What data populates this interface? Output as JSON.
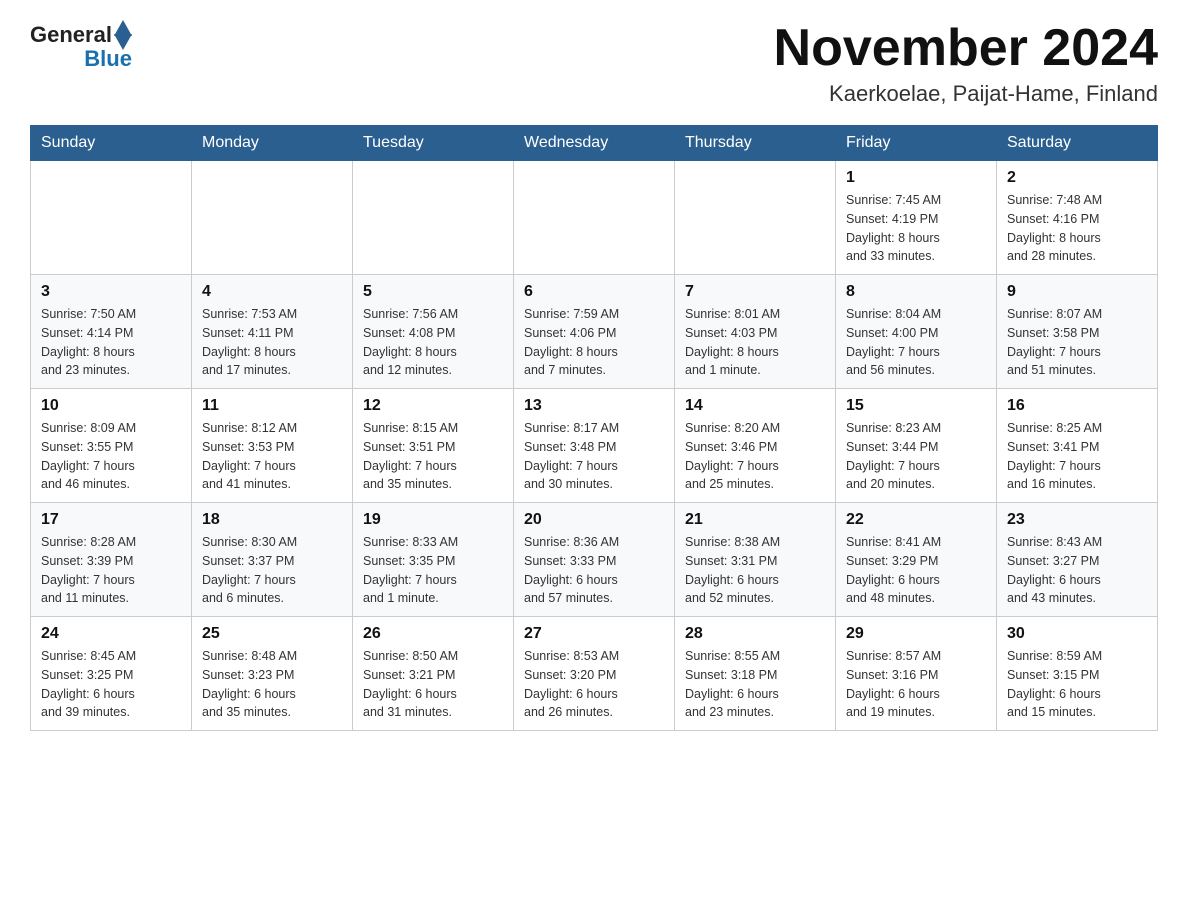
{
  "header": {
    "logo": {
      "general": "General",
      "blue": "Blue"
    },
    "title": "November 2024",
    "subtitle": "Kaerkoelae, Paijat-Hame, Finland"
  },
  "weekdays": [
    "Sunday",
    "Monday",
    "Tuesday",
    "Wednesday",
    "Thursday",
    "Friday",
    "Saturday"
  ],
  "weeks": [
    [
      {
        "day": "",
        "info": ""
      },
      {
        "day": "",
        "info": ""
      },
      {
        "day": "",
        "info": ""
      },
      {
        "day": "",
        "info": ""
      },
      {
        "day": "",
        "info": ""
      },
      {
        "day": "1",
        "info": "Sunrise: 7:45 AM\nSunset: 4:19 PM\nDaylight: 8 hours\nand 33 minutes."
      },
      {
        "day": "2",
        "info": "Sunrise: 7:48 AM\nSunset: 4:16 PM\nDaylight: 8 hours\nand 28 minutes."
      }
    ],
    [
      {
        "day": "3",
        "info": "Sunrise: 7:50 AM\nSunset: 4:14 PM\nDaylight: 8 hours\nand 23 minutes."
      },
      {
        "day": "4",
        "info": "Sunrise: 7:53 AM\nSunset: 4:11 PM\nDaylight: 8 hours\nand 17 minutes."
      },
      {
        "day": "5",
        "info": "Sunrise: 7:56 AM\nSunset: 4:08 PM\nDaylight: 8 hours\nand 12 minutes."
      },
      {
        "day": "6",
        "info": "Sunrise: 7:59 AM\nSunset: 4:06 PM\nDaylight: 8 hours\nand 7 minutes."
      },
      {
        "day": "7",
        "info": "Sunrise: 8:01 AM\nSunset: 4:03 PM\nDaylight: 8 hours\nand 1 minute."
      },
      {
        "day": "8",
        "info": "Sunrise: 8:04 AM\nSunset: 4:00 PM\nDaylight: 7 hours\nand 56 minutes."
      },
      {
        "day": "9",
        "info": "Sunrise: 8:07 AM\nSunset: 3:58 PM\nDaylight: 7 hours\nand 51 minutes."
      }
    ],
    [
      {
        "day": "10",
        "info": "Sunrise: 8:09 AM\nSunset: 3:55 PM\nDaylight: 7 hours\nand 46 minutes."
      },
      {
        "day": "11",
        "info": "Sunrise: 8:12 AM\nSunset: 3:53 PM\nDaylight: 7 hours\nand 41 minutes."
      },
      {
        "day": "12",
        "info": "Sunrise: 8:15 AM\nSunset: 3:51 PM\nDaylight: 7 hours\nand 35 minutes."
      },
      {
        "day": "13",
        "info": "Sunrise: 8:17 AM\nSunset: 3:48 PM\nDaylight: 7 hours\nand 30 minutes."
      },
      {
        "day": "14",
        "info": "Sunrise: 8:20 AM\nSunset: 3:46 PM\nDaylight: 7 hours\nand 25 minutes."
      },
      {
        "day": "15",
        "info": "Sunrise: 8:23 AM\nSunset: 3:44 PM\nDaylight: 7 hours\nand 20 minutes."
      },
      {
        "day": "16",
        "info": "Sunrise: 8:25 AM\nSunset: 3:41 PM\nDaylight: 7 hours\nand 16 minutes."
      }
    ],
    [
      {
        "day": "17",
        "info": "Sunrise: 8:28 AM\nSunset: 3:39 PM\nDaylight: 7 hours\nand 11 minutes."
      },
      {
        "day": "18",
        "info": "Sunrise: 8:30 AM\nSunset: 3:37 PM\nDaylight: 7 hours\nand 6 minutes."
      },
      {
        "day": "19",
        "info": "Sunrise: 8:33 AM\nSunset: 3:35 PM\nDaylight: 7 hours\nand 1 minute."
      },
      {
        "day": "20",
        "info": "Sunrise: 8:36 AM\nSunset: 3:33 PM\nDaylight: 6 hours\nand 57 minutes."
      },
      {
        "day": "21",
        "info": "Sunrise: 8:38 AM\nSunset: 3:31 PM\nDaylight: 6 hours\nand 52 minutes."
      },
      {
        "day": "22",
        "info": "Sunrise: 8:41 AM\nSunset: 3:29 PM\nDaylight: 6 hours\nand 48 minutes."
      },
      {
        "day": "23",
        "info": "Sunrise: 8:43 AM\nSunset: 3:27 PM\nDaylight: 6 hours\nand 43 minutes."
      }
    ],
    [
      {
        "day": "24",
        "info": "Sunrise: 8:45 AM\nSunset: 3:25 PM\nDaylight: 6 hours\nand 39 minutes."
      },
      {
        "day": "25",
        "info": "Sunrise: 8:48 AM\nSunset: 3:23 PM\nDaylight: 6 hours\nand 35 minutes."
      },
      {
        "day": "26",
        "info": "Sunrise: 8:50 AM\nSunset: 3:21 PM\nDaylight: 6 hours\nand 31 minutes."
      },
      {
        "day": "27",
        "info": "Sunrise: 8:53 AM\nSunset: 3:20 PM\nDaylight: 6 hours\nand 26 minutes."
      },
      {
        "day": "28",
        "info": "Sunrise: 8:55 AM\nSunset: 3:18 PM\nDaylight: 6 hours\nand 23 minutes."
      },
      {
        "day": "29",
        "info": "Sunrise: 8:57 AM\nSunset: 3:16 PM\nDaylight: 6 hours\nand 19 minutes."
      },
      {
        "day": "30",
        "info": "Sunrise: 8:59 AM\nSunset: 3:15 PM\nDaylight: 6 hours\nand 15 minutes."
      }
    ]
  ]
}
